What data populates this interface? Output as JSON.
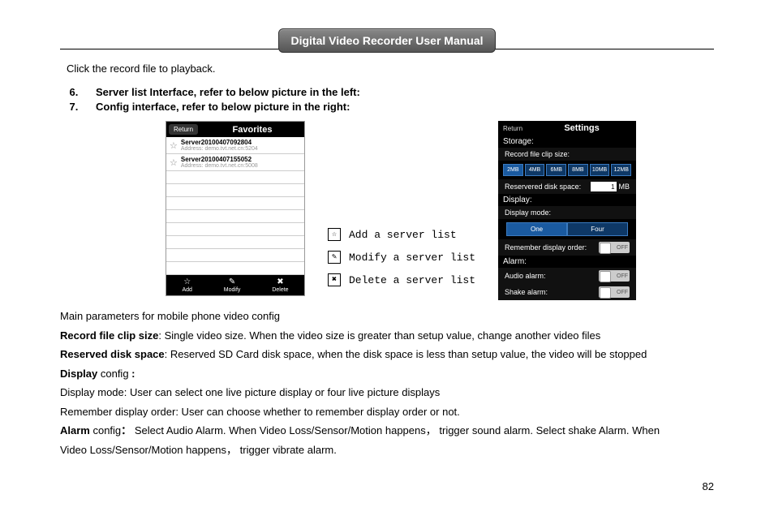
{
  "title": "Digital Video Recorder User Manual",
  "intro": "Click the record file to playback.",
  "bullets": {
    "start": 6,
    "items": [
      "Server list Interface, refer to below picture in the left:",
      "Config interface, refer to below picture in the right:"
    ]
  },
  "favorites": {
    "return": "Return",
    "title": "Favorites",
    "rows": [
      {
        "name": "Server20100407092804",
        "addr": "Address: demo.tvt.net.cn:5204"
      },
      {
        "name": "Server20100407155052",
        "addr": "Address: demo.tvt.net.cn:5008"
      }
    ],
    "footer": {
      "add": "Add",
      "modify": "Modify",
      "delete": "Delete"
    }
  },
  "legend": {
    "add": "Add a server list",
    "modify": "Modify a server list",
    "delete": "Delete a server list"
  },
  "settings": {
    "return": "Return",
    "title": "Settings",
    "storage_label": "Storage:",
    "clip_label": "Record file clip size:",
    "clip_opts": [
      "2MB",
      "4MB",
      "6MB",
      "8MB",
      "10MB",
      "12MB"
    ],
    "reserved_label": "Reservered disk space:",
    "reserved_value": "1",
    "reserved_unit": "MB",
    "display_label": "Display:",
    "mode_label": "Display mode:",
    "mode_opts": [
      "One",
      "Four"
    ],
    "remember_label": "Remember display order:",
    "alarm_label": "Alarm:",
    "audio_label": "Audio alarm:",
    "shake_label": "Shake alarm:",
    "off": "OFF"
  },
  "para": {
    "main": "Main parameters for mobile phone video config",
    "rec_b": "Record file clip size",
    "rec_t": ": Single video size. When the video size is greater than setup value, change another video files",
    "res_b": "Reserved disk space",
    "res_t": ": Reserved SD Card disk space, when the disk space is less than setup value, the video will be stopped",
    "disp_b": "Display",
    "disp_t": " config",
    "disp_colon": " :",
    "mode": "Display mode: User can select one live picture display or four live picture displays",
    "rem": "Remember display order: User can choose whether to remember display order or not.",
    "alarm_b": "Alarm",
    "alarm_t": " config",
    "alarm_rest": "Select Audio Alarm. When Video Loss/Sensor/Motion happens",
    "alarm_rest2": "trigger sound alarm. Select shake Alarm. When",
    "alarm_line2": "Video Loss/Sensor/Motion happens",
    "alarm_line2b": "trigger vibrate alarm.",
    "comma": "，",
    "colon": "："
  },
  "page_number": "82"
}
